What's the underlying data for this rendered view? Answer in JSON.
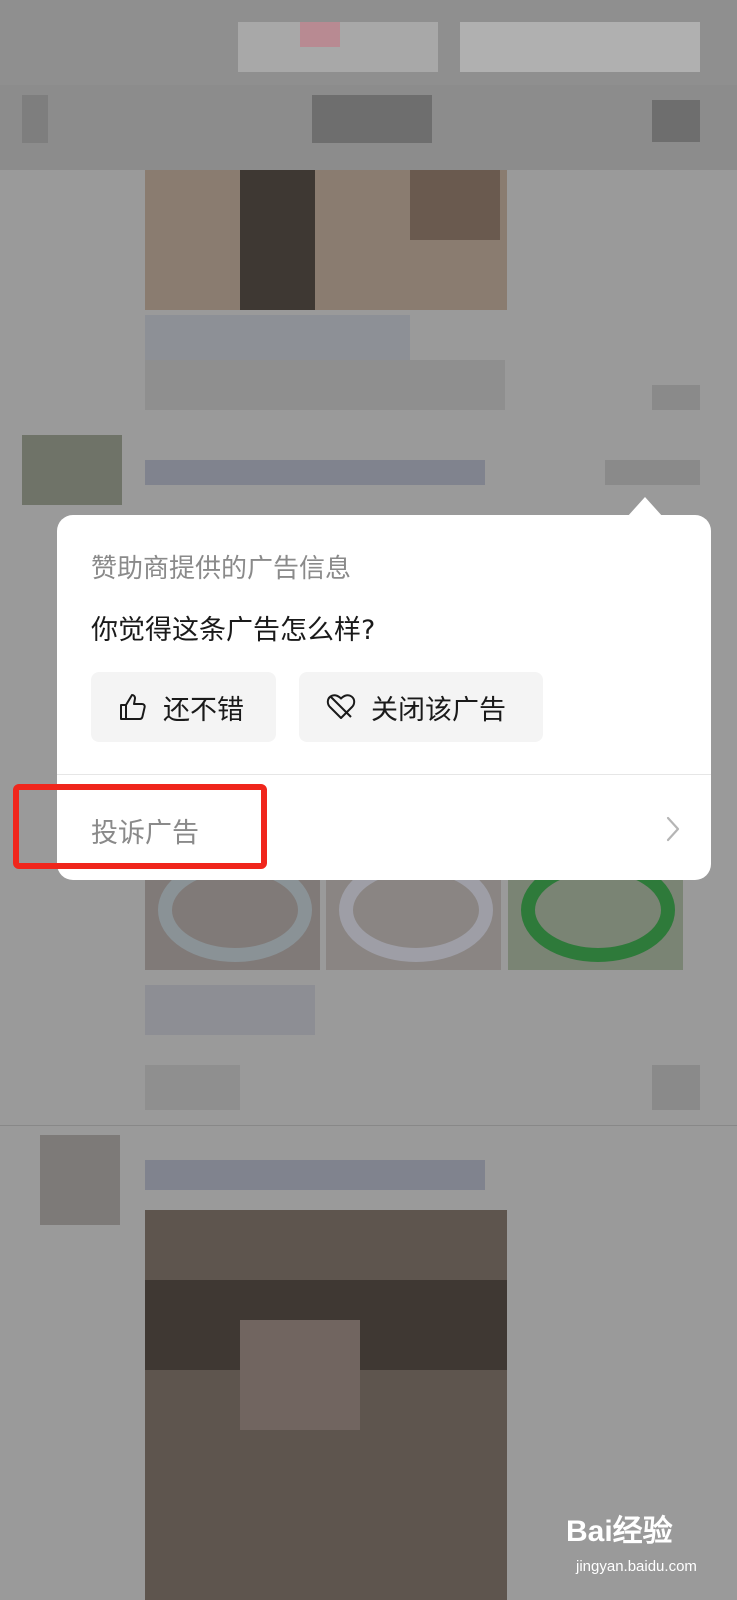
{
  "popup": {
    "caption": "赞助商提供的广告信息",
    "question": "你觉得这条广告怎么样?",
    "like_button": {
      "label": "还不错",
      "icon": "thumbs-up-icon"
    },
    "close_button": {
      "label": "关闭该广告",
      "icon": "broken-heart-icon"
    },
    "report_row": {
      "label": "投诉广告",
      "icon": "chevron-right-icon"
    }
  },
  "highlight": {
    "color": "#f0261c"
  },
  "watermark": {
    "logo": "Bai经验",
    "url": "jingyan.baidu.com"
  }
}
